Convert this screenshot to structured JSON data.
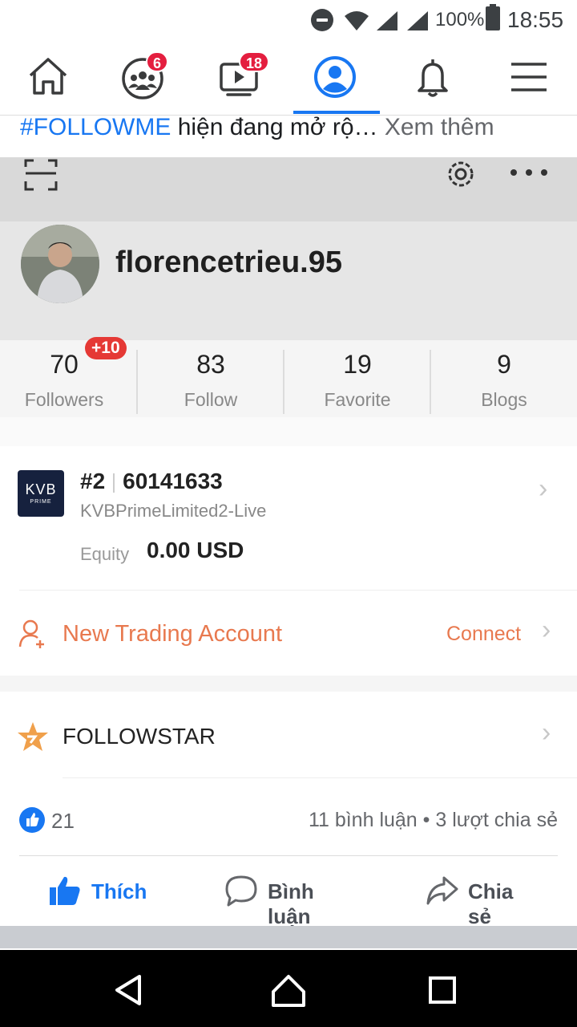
{
  "status_bar": {
    "battery": "100%",
    "time": "18:55"
  },
  "nav": {
    "groups_badge": "6",
    "watch_badge": "18",
    "active_tab": "profile"
  },
  "post": {
    "hashtag": "#FOLLOWME",
    "text": " hiện đang mở rộ…",
    "see_more": " Xem thêm"
  },
  "profile": {
    "username": "florencetrieu.95",
    "stats": [
      {
        "value": "70",
        "label": "Followers"
      },
      {
        "value": "83",
        "label": "Follow"
      },
      {
        "value": "19",
        "label": "Favorite"
      },
      {
        "value": "9",
        "label": "Blogs"
      }
    ],
    "followers_new": "+10"
  },
  "account": {
    "logo_text": "KVB",
    "logo_sub": "PRIME",
    "rank": "#2",
    "number": "60141633",
    "server": "KVBPrimeLimited2-Live",
    "equity_label": "Equity",
    "equity_value": "0.00 USD"
  },
  "new_account": {
    "label": "New Trading Account",
    "action": "Connect"
  },
  "followstar": {
    "label": "FOLLOWSTAR"
  },
  "reactions": {
    "likes": "21",
    "comments_shares": "11 bình luận • 3 lượt chia sẻ"
  },
  "actions": {
    "like": "Thích",
    "comment": "Bình luận",
    "share": "Chia sẻ"
  },
  "colors": {
    "fb_blue": "#1877f2",
    "accent_orange": "#e8794f",
    "badge_red": "#e41e3f"
  }
}
